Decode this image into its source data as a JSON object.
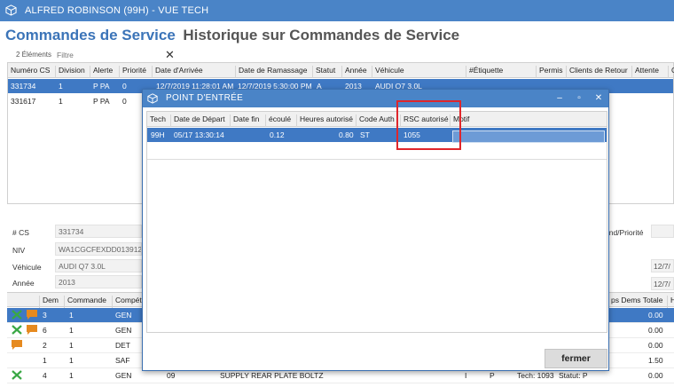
{
  "window": {
    "title": "ALFRED ROBINSON (99H) - VUE TECH",
    "accent": "#4a84c7"
  },
  "headings": {
    "primary": "Commandes de Service",
    "secondary": "Historique sur Commandes de Service"
  },
  "list": {
    "count": "2 Éléments",
    "filter_placeholder": "Filtre",
    "clear_icon": "close-icon"
  },
  "main_grid": {
    "columns": [
      "Numéro CS",
      "Division",
      "Alerte",
      "Priorité",
      "Date d'Arrivée",
      "Date de Ramassage",
      "Statut",
      "Année",
      "Véhicule",
      "#Étiquette",
      "Permis",
      "Clients de Retour",
      "Attente",
      "C"
    ],
    "rows": [
      {
        "cs": "331734",
        "division": "1",
        "alerte": "P PA",
        "priorite": "0",
        "arrivee": "12/7/2019 11:28:01 AM",
        "ramassage": "12/7/2019 5:30:00 PM",
        "statut": "A",
        "annee": "2013",
        "vehicule": "AUDI Q7 3.0L"
      },
      {
        "cs": "331617",
        "division": "1",
        "alerte": "P PA",
        "priorite": "0"
      }
    ]
  },
  "details": {
    "cs_label": "# CS",
    "cs_value": "331734",
    "niv_label": "NIV",
    "niv_value": "WA1CGCFEXDD013912",
    "vehicule_label": "Véhicule",
    "vehicule_value": "AUDI Q7 3.0L",
    "annee_label": "Année",
    "annee_value": "2013",
    "right_label": "end/Priorité",
    "right_value_1": "12/7/",
    "right_value_2": "12/7/"
  },
  "dem_grid": {
    "columns": [
      "Dem",
      "Commande",
      "Compét",
      "ps Dems Totale",
      "H"
    ],
    "rows": [
      {
        "dem": "3",
        "commande": "1",
        "comp": "GEN",
        "total": "0.00",
        "icons": [
          "wrench-icon",
          "comment-icon"
        ]
      },
      {
        "dem": "6",
        "commande": "1",
        "comp": "GEN",
        "total": "0.00",
        "icons": [
          "wrench-icon",
          "comment-icon"
        ]
      },
      {
        "dem": "2",
        "commande": "1",
        "comp": "DET",
        "total": "0.00",
        "icons": [
          "comment-icon"
        ]
      },
      {
        "dem": "1",
        "commande": "1",
        "comp": "SAF",
        "total": "1.50",
        "icons": []
      },
      {
        "dem": "4",
        "commande": "1",
        "comp": "GEN",
        "code": "09",
        "desc": "SUPPLY REAR PLATE BOLTZ",
        "col_i": "I",
        "col_p": "P",
        "tech": "Tech: 1093",
        "statut": "Statut: P",
        "total": "0.00",
        "icons": [
          "wrench-icon"
        ]
      }
    ]
  },
  "dialog": {
    "title": "POINT D'ENTRÉE",
    "columns": [
      "Tech",
      "Date de Départ",
      "Date fin",
      "écoulé",
      "Heures autorisé",
      "Code Auth",
      "RSC autorisé",
      "Motif"
    ],
    "row": {
      "tech": "99H",
      "depart": "05/17 13:30:14",
      "fin": "",
      "ecoule": "0.12",
      "heures": "0.80",
      "code": "ST",
      "rsc": "1055",
      "motif": ""
    },
    "close_label": "fermer",
    "highlight_color": "#e0262b"
  }
}
